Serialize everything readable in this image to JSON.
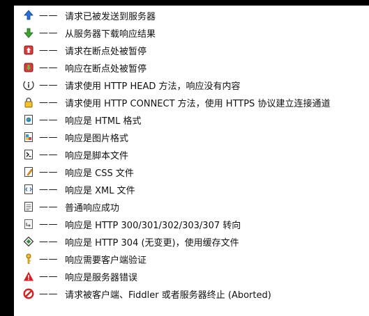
{
  "legend": {
    "rows": [
      {
        "icon": "up-arrow-icon",
        "sep": "——",
        "text": "请求已被发送到服务器"
      },
      {
        "icon": "down-arrow-icon",
        "sep": "——",
        "text": "从服务器下载响应结果"
      },
      {
        "icon": "request-breakpoint-icon",
        "sep": "——",
        "text": "请求在断点处被暂停"
      },
      {
        "icon": "response-breakpoint-icon",
        "sep": "——",
        "text": "响应在断点处被暂停"
      },
      {
        "icon": "info-icon",
        "sep": "——",
        "text": "请求使用 HTTP HEAD 方法，响应没有内容"
      },
      {
        "icon": "lock-icon",
        "sep": "——",
        "text": "请求使用 HTTP CONNECT 方法，使用 HTTPS 协议建立连接通道"
      },
      {
        "icon": "html-document-icon",
        "sep": "——",
        "text": "响应是 HTML 格式"
      },
      {
        "icon": "image-document-icon",
        "sep": "——",
        "text": "响应是图片格式"
      },
      {
        "icon": "script-document-icon",
        "sep": "——",
        "text": "响应是脚本文件"
      },
      {
        "icon": "css-document-icon",
        "sep": "——",
        "text": "响应是 CSS 文件"
      },
      {
        "icon": "xml-document-icon",
        "sep": "——",
        "text": "响应是 XML 文件"
      },
      {
        "icon": "plain-document-icon",
        "sep": "——",
        "text": "普通响应成功"
      },
      {
        "icon": "redirect-document-icon",
        "sep": "——",
        "text": "响应是 HTTP 300/301/302/303/307 转向"
      },
      {
        "icon": "cache-diamond-icon",
        "sep": "——",
        "text": "响应是 HTTP 304 (无变更)，使用缓存文件"
      },
      {
        "icon": "key-icon",
        "sep": "——",
        "text": "响应需要客户端验证"
      },
      {
        "icon": "warning-icon",
        "sep": "——",
        "text": "响应是服务器错误"
      },
      {
        "icon": "aborted-icon",
        "sep": "——",
        "text": "请求被客户端、Fiddler 或者服务器终止 (Aborted)"
      }
    ]
  }
}
